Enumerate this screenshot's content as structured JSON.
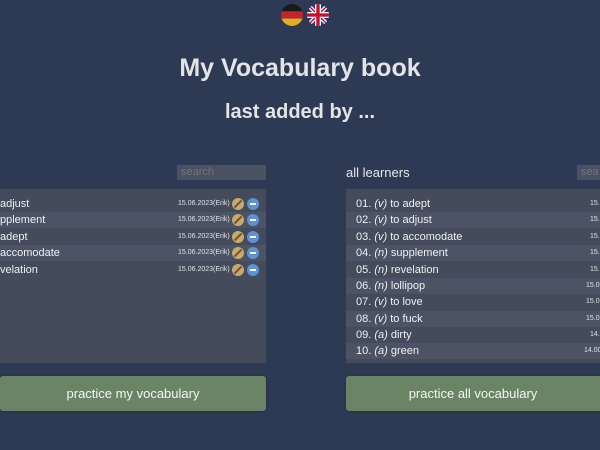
{
  "flags": {
    "german": "german-flag-icon",
    "english": "uk-flag-icon"
  },
  "title": "My Vocabulary book",
  "subtitle": "last added by ...",
  "left_panel": {
    "search_placeholder": "search",
    "items": [
      {
        "word": "adjust",
        "date": "15.06.2023(Erik)"
      },
      {
        "word": "pplement",
        "date": "15.06.2023(Erik)"
      },
      {
        "word": "adept",
        "date": "15.06.2023(Erik)"
      },
      {
        "word": "accomodate",
        "date": "15.06.2023(Erik)"
      },
      {
        "word": "velation",
        "date": "15.06.2023(Erik)"
      }
    ],
    "button": "practice my vocabulary"
  },
  "right_panel": {
    "label": "all learners",
    "search_placeholder": "sear",
    "items": [
      {
        "num": "01.",
        "type": "(v)",
        "word": "to adept",
        "date": "15."
      },
      {
        "num": "02.",
        "type": "(v)",
        "word": "to adjust",
        "date": "15."
      },
      {
        "num": "03.",
        "type": "(v)",
        "word": "to accomodate",
        "date": "15."
      },
      {
        "num": "04.",
        "type": "(n)",
        "word": "supplement",
        "date": "15."
      },
      {
        "num": "05.",
        "type": "(n)",
        "word": "revelation",
        "date": "15."
      },
      {
        "num": "06.",
        "type": "(n)",
        "word": "lollipop",
        "date": "15.0"
      },
      {
        "num": "07.",
        "type": "(v)",
        "word": "to love",
        "date": "15.0"
      },
      {
        "num": "08.",
        "type": "(v)",
        "word": "to fuck",
        "date": "15.0"
      },
      {
        "num": "09.",
        "type": "(a)",
        "word": "dirty",
        "date": "14."
      },
      {
        "num": "10.",
        "type": "(a)",
        "word": "green",
        "date": "14.00"
      }
    ],
    "button": "practice all vocabulary"
  }
}
